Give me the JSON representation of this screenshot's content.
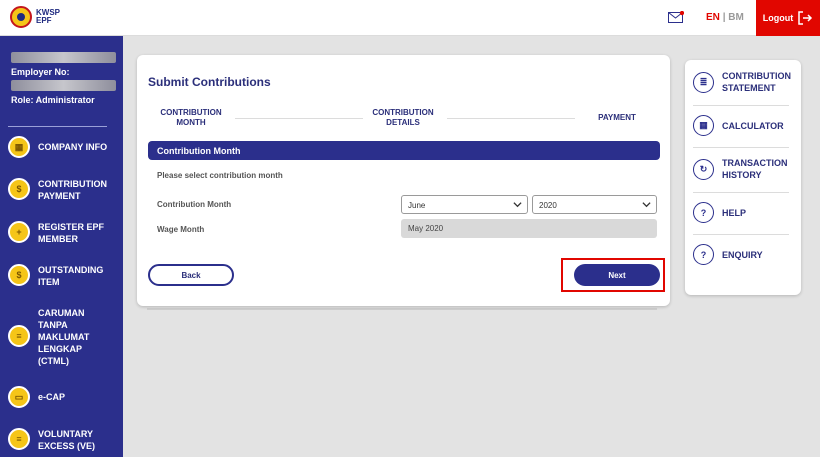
{
  "header": {
    "logo_line1": "KWSP",
    "logo_line2": "EPF",
    "lang_en": "EN",
    "lang_sep": "|",
    "lang_bm": "BM",
    "logout_label": "Logout"
  },
  "sidebar": {
    "employer_label": "Employer No:",
    "role_label": "Role: Administrator",
    "items": [
      {
        "label": "COMPANY INFO",
        "icon": "building-icon"
      },
      {
        "label": "CONTRIBUTION PAYMENT",
        "icon": "money-icon"
      },
      {
        "label": "REGISTER EPF MEMBER",
        "icon": "user-add-icon"
      },
      {
        "label": "OUTSTANDING ITEM",
        "icon": "dollar-icon"
      },
      {
        "label": "CARUMAN TANPA MAKLUMAT LENGKAP (CTML)",
        "icon": "document-icon"
      },
      {
        "label": "e-CAP",
        "icon": "card-icon"
      },
      {
        "label": "VOLUNTARY EXCESS (VE)",
        "icon": "document-icon"
      }
    ]
  },
  "main": {
    "title": "Submit Contributions",
    "steps": [
      "CONTRIBUTION MONTH",
      "CONTRIBUTION DETAILS",
      "PAYMENT"
    ],
    "section_title": "Contribution Month",
    "instruction": "Please select contribution month",
    "contribution_month_label": "Contribution Month",
    "month_value": "June",
    "year_value": "2020",
    "wage_month_label": "Wage Month",
    "wage_month_value": "May 2020",
    "back_label": "Back",
    "next_label": "Next"
  },
  "right_panel": {
    "items": [
      {
        "label": "CONTRIBUTION STATEMENT",
        "icon": "statement-icon"
      },
      {
        "label": "CALCULATOR",
        "icon": "calculator-icon"
      },
      {
        "label": "TRANSACTION HISTORY",
        "icon": "history-icon"
      },
      {
        "label": "HELP",
        "icon": "help-icon"
      },
      {
        "label": "ENQUIRY",
        "icon": "enquiry-icon"
      }
    ]
  },
  "colors": {
    "primary": "#2b2f8c",
    "accent_red": "#e10600",
    "seal_yellow": "#f5c518"
  }
}
